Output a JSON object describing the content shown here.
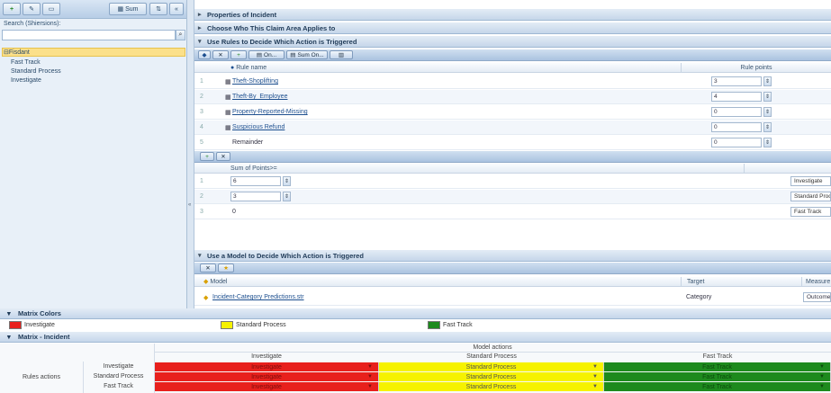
{
  "left_panel": {
    "toolbar_label": "Sum",
    "search_label": "Search (Shiersions):",
    "tree_root": "Fisdant",
    "tree_items": [
      "Fast Track",
      "Standard Process",
      "Investigate"
    ]
  },
  "sections": {
    "properties": "Properties of Incident",
    "choose": "Choose Who This Claim Area Applies to",
    "rules": "Use Rules to Decide Which Action is Triggered",
    "model": "Use a Model to Decide Which Action is Triggered"
  },
  "rules_toolbar": {
    "btn1": "On...",
    "btn2": "Sum On..."
  },
  "rules_table": {
    "col_name": "Rule name",
    "col_points": "Rule points",
    "rows": [
      {
        "num": "1",
        "name": "Theft-Shoplifting",
        "points": "3",
        "link": true
      },
      {
        "num": "2",
        "name": "Theft-By_Employee",
        "points": "4",
        "link": true
      },
      {
        "num": "3",
        "name": "Property-Reported-Missing",
        "points": "0",
        "link": true
      },
      {
        "num": "4",
        "name": "Suspicious Refund",
        "points": "0",
        "link": true
      },
      {
        "num": "5",
        "name": "Remainder",
        "points": "0",
        "link": false
      }
    ]
  },
  "sum_table": {
    "col": "Sum of Points>=",
    "rows": [
      {
        "num": "1",
        "value": "6",
        "action": "Investigate"
      },
      {
        "num": "2",
        "value": "3",
        "action": "Standard Process"
      },
      {
        "num": "3",
        "value": "0",
        "action": "Fast Track"
      }
    ]
  },
  "model_table": {
    "col_model": "Model",
    "col_target": "Target",
    "col_measure": "Measure",
    "row": {
      "model": "Incident-Category Predictions.str",
      "target": "Category",
      "measure": "Outcome"
    }
  },
  "matrix_colors": {
    "title": "Matrix Colors",
    "items": [
      {
        "label": "Investigate",
        "color": "#e8201c"
      },
      {
        "label": "Standard Process",
        "color": "#f6f200"
      },
      {
        "label": "Fast Track",
        "color": "#1d8a1d"
      }
    ]
  },
  "matrix": {
    "title": "Matrix - Incident",
    "model_actions": "Model actions",
    "rules_actions": "Rules actions",
    "columns": [
      "Investigate",
      "Standard Process",
      "Fast Track"
    ],
    "rows": [
      {
        "label": "Investigate",
        "cells": [
          "Investigate",
          "Standard Process",
          "Fast Track"
        ]
      },
      {
        "label": "Standard Process",
        "cells": [
          "Investigate",
          "Standard Process",
          "Fast Track"
        ]
      },
      {
        "label": "Fast Track",
        "cells": [
          "Investigate",
          "Standard Process",
          "Fast Track"
        ]
      }
    ]
  }
}
